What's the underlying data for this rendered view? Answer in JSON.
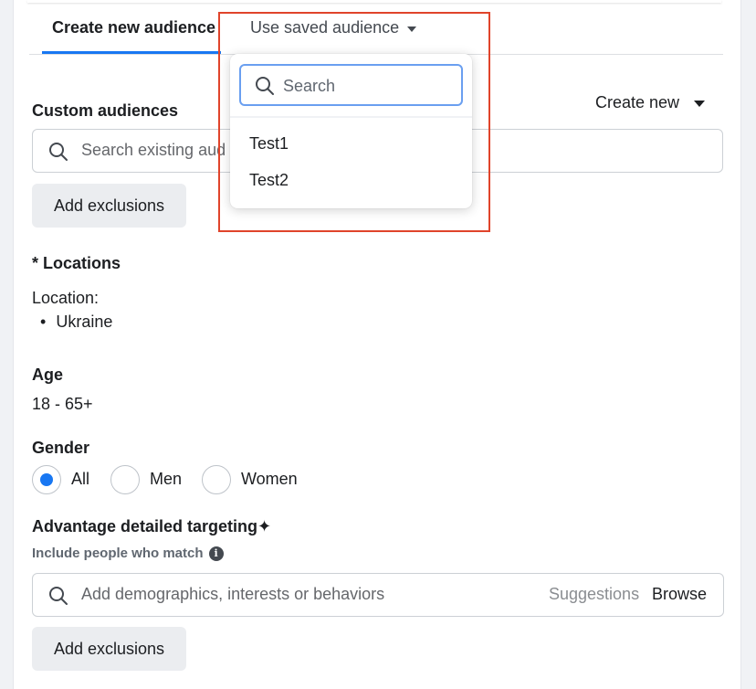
{
  "tabs": {
    "create_new": "Create new audience",
    "use_saved": "Use saved audience"
  },
  "custom_audiences": {
    "label": "Custom audiences",
    "create_new": "Create new",
    "search_placeholder": "Search existing aud",
    "add_exclusions": "Add exclusions"
  },
  "locations": {
    "label": "* Locations",
    "location_label": "Location:",
    "items": [
      "Ukraine"
    ]
  },
  "age": {
    "label": "Age",
    "value": "18 - 65+"
  },
  "gender": {
    "label": "Gender",
    "options": [
      "All",
      "Men",
      "Women"
    ],
    "selected": "All"
  },
  "detailed_targeting": {
    "label": "Advantage detailed targeting",
    "sparkle": "✦",
    "sublabel": "Include people who match",
    "info": "i",
    "search_placeholder": "Add demographics, interests or behaviors",
    "suggestions": "Suggestions",
    "browse": "Browse",
    "add_exclusions": "Add exclusions"
  },
  "saved_dropdown": {
    "search_placeholder": "Search",
    "items": [
      "Test1",
      "Test2"
    ]
  },
  "colors": {
    "accent": "#1877f2",
    "highlight": "#e0442b"
  }
}
